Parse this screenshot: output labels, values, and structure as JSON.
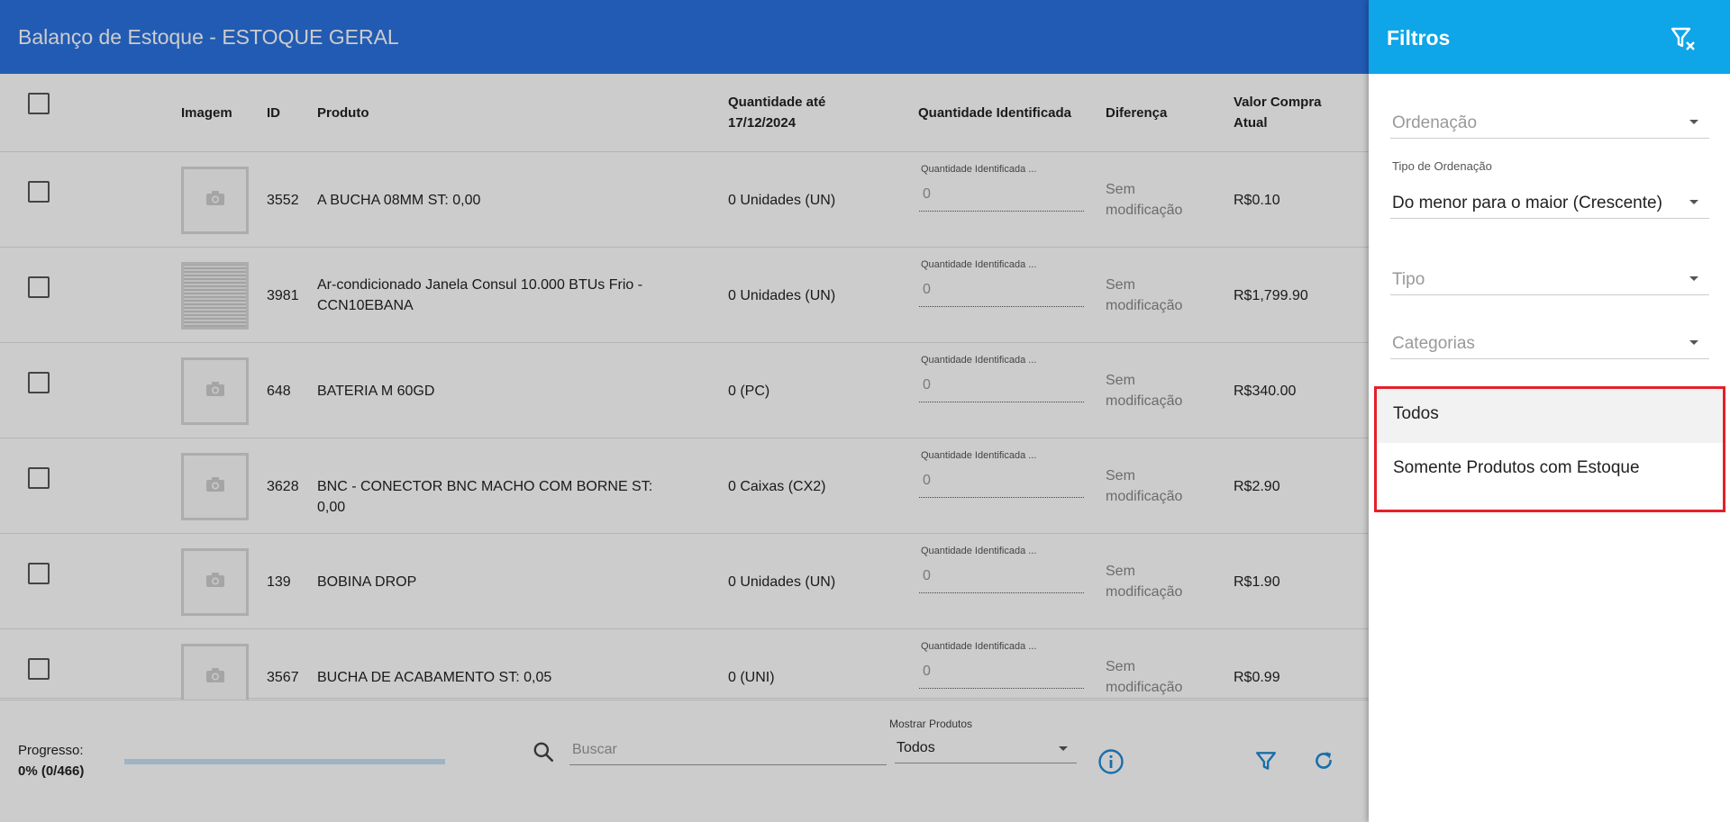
{
  "header": {
    "title": "Balanço de Estoque - ESTOQUE GERAL"
  },
  "table": {
    "columns": {
      "image": "Imagem",
      "id": "ID",
      "product": "Produto",
      "qty_until": "Quantidade até 17/12/2024",
      "qty_identified": "Quantidade Identificada",
      "difference": "Diferença",
      "purchase_value": "Valor Compra Atual"
    },
    "rows": [
      {
        "id": "3552",
        "product": "A BUCHA 08MM ST: 0,00",
        "qty": "0 Unidades (UN)",
        "qty_label": "Quantidade Identificada ...",
        "qty_value": "0",
        "diff": "Sem modificação",
        "value": "R$0.10",
        "has_image": false
      },
      {
        "id": "3981",
        "product": "Ar-condicionado Janela Consul 10.000 BTUs Frio - CCN10EBANA",
        "qty": "0 Unidades (UN)",
        "qty_label": "Quantidade Identificada ...",
        "qty_value": "0",
        "diff": "Sem modificação",
        "value": "R$1,799.90",
        "has_image": true
      },
      {
        "id": "648",
        "product": "BATERIA M 60GD",
        "qty": "0 (PC)",
        "qty_label": "Quantidade Identificada ...",
        "qty_value": "0",
        "diff": "Sem modificação",
        "value": "R$340.00",
        "has_image": false
      },
      {
        "id": "3628",
        "product": "BNC - CONECTOR BNC MACHO COM BORNE ST: 0,00",
        "qty": "0 Caixas (CX2)",
        "qty_label": "Quantidade Identificada ...",
        "qty_value": "0",
        "diff": "Sem modificação",
        "value": "R$2.90",
        "has_image": false
      },
      {
        "id": "139",
        "product": "BOBINA DROP",
        "qty": "0 Unidades (UN)",
        "qty_label": "Quantidade Identificada ...",
        "qty_value": "0",
        "diff": "Sem modificação",
        "value": "R$1.90",
        "has_image": false
      },
      {
        "id": "3567",
        "product": "BUCHA DE ACABAMENTO ST: 0,05",
        "qty": "0 (UNI)",
        "qty_label": "Quantidade Identificada ...",
        "qty_value": "0",
        "diff": "Sem modificação",
        "value": "R$0.99",
        "has_image": false
      }
    ]
  },
  "footer": {
    "progress_label": "Progresso:",
    "progress_value": "0% (0/466)",
    "progress_fraction": 0,
    "search_placeholder": "Buscar",
    "show_products_label": "Mostrar Produtos",
    "show_products_value": "Todos"
  },
  "drawer": {
    "title": "Filtros",
    "ordering_placeholder": "Ordenação",
    "ordering_type_label": "Tipo de Ordenação",
    "ordering_type_value": "Do menor para o maior (Crescente)",
    "type_placeholder": "Tipo",
    "categories_placeholder": "Categorias",
    "menu_options": [
      "Todos",
      "Somente Produtos com Estoque"
    ]
  },
  "colors": {
    "header_blue": "#2b72e0",
    "drawer_header": "#0ea5e9",
    "highlight_red": "#e4202a",
    "icon_blue": "#1f8ad6"
  },
  "icons": [
    "camera-icon",
    "search-icon",
    "info-icon",
    "filter-icon",
    "refresh-icon",
    "clear-filter-icon"
  ]
}
